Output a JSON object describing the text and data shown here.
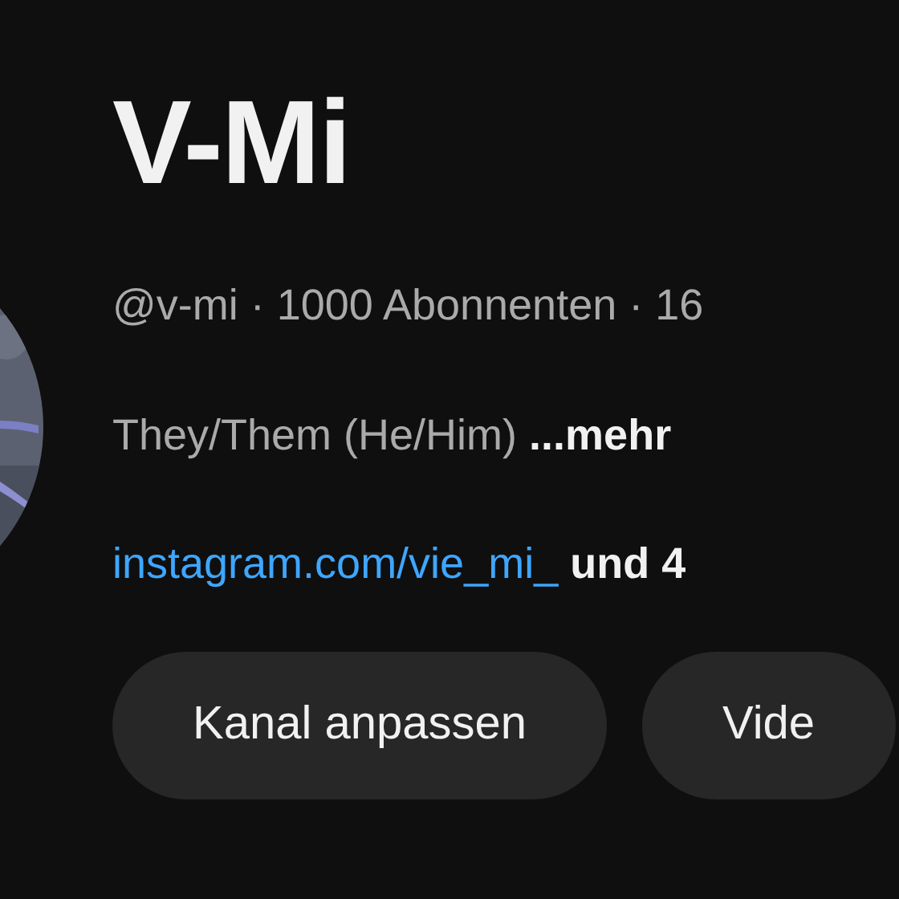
{
  "channel": {
    "name": "V-Mi",
    "meta": "@v-mi · 1000 Abonnenten · 16",
    "description": "They/Them (He/Him)",
    "more_link": "...mehr",
    "link": "instagram.com/vie_mi_",
    "more_links": "und 4"
  },
  "buttons": [
    "Kanal anpassen",
    "Vide"
  ]
}
